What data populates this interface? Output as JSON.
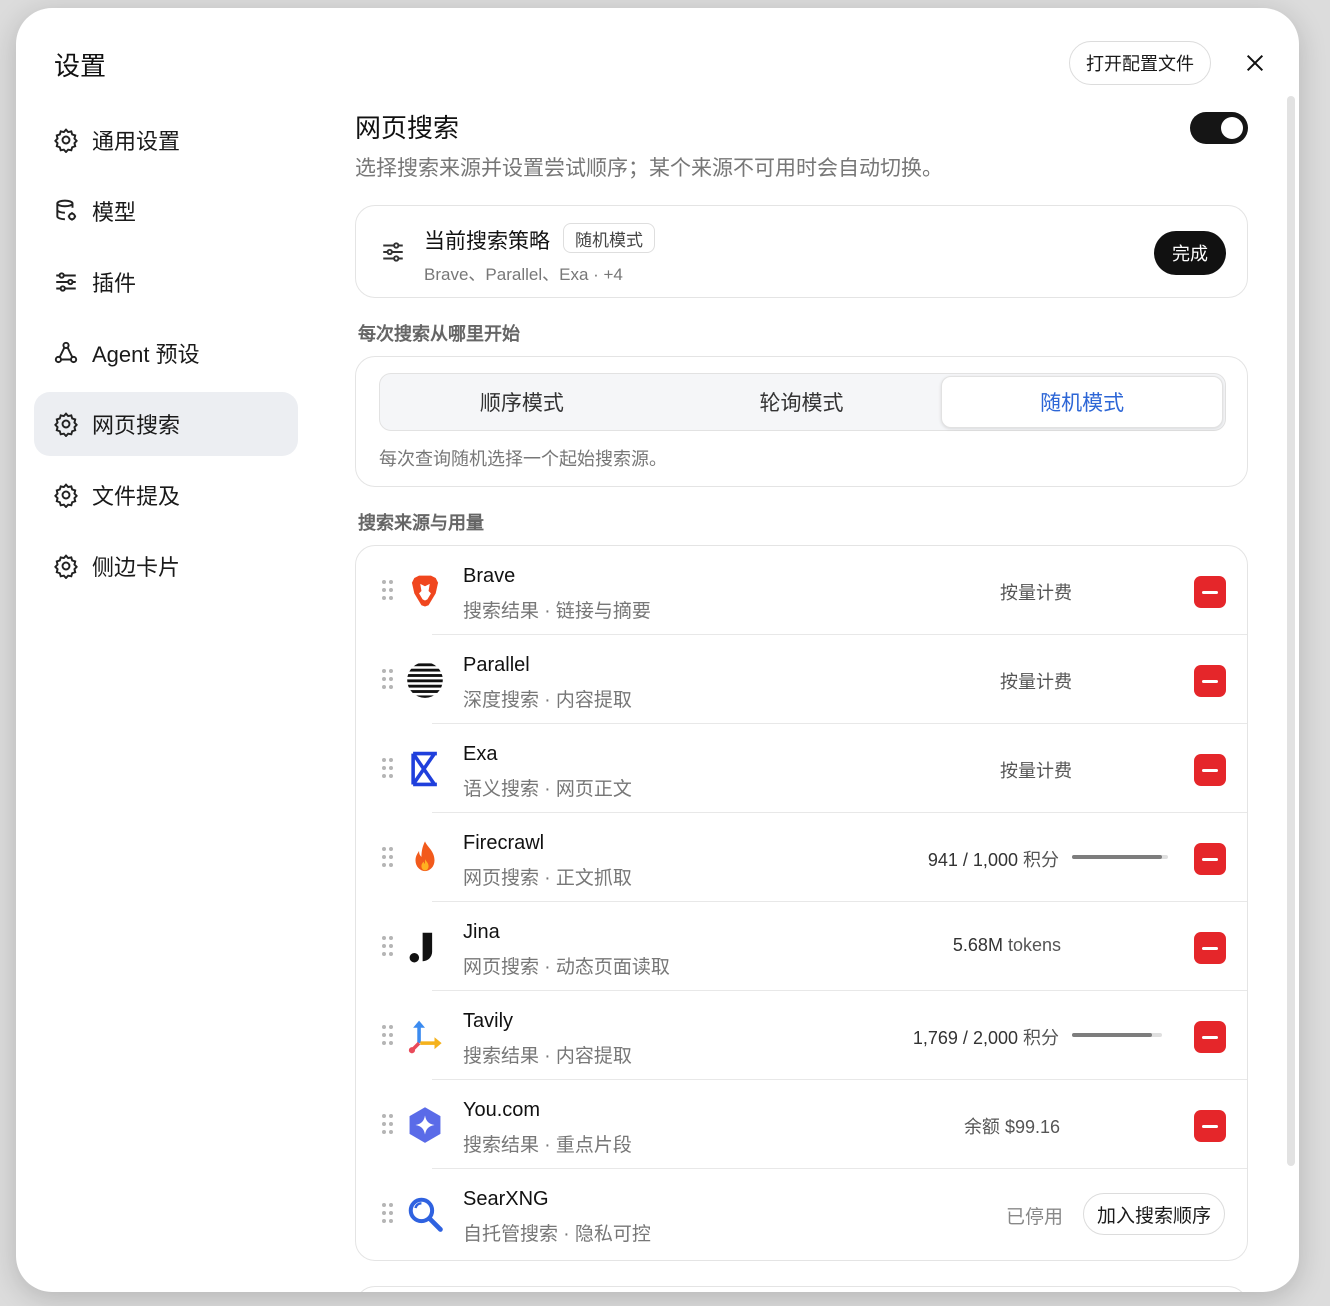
{
  "modal": {
    "title": "设置",
    "open_config_label": "打开配置文件"
  },
  "nav": [
    {
      "label": "通用设置",
      "icon": "gear-icon"
    },
    {
      "label": "模型",
      "icon": "database-icon"
    },
    {
      "label": "插件",
      "icon": "sliders-icon"
    },
    {
      "label": "Agent 预设",
      "icon": "agent-icon"
    },
    {
      "label": "网页搜索",
      "icon": "gear-icon",
      "active": true
    },
    {
      "label": "文件提及",
      "icon": "gear-icon"
    },
    {
      "label": "侧边卡片",
      "icon": "gear-icon"
    }
  ],
  "web_search": {
    "title": "网页搜索",
    "description": "选择搜索来源并设置尝试顺序；某个来源不可用时会自动切换。",
    "enabled": true,
    "strategy": {
      "title": "当前搜索策略",
      "badge": "随机模式",
      "summary": "Brave、Parallel、Exa · +4",
      "done_label": "完成"
    },
    "start_label": "每次搜索从哪里开始",
    "modes": [
      "顺序模式",
      "轮询模式",
      "随机模式"
    ],
    "active_mode": "随机模式",
    "mode_description": "每次查询随机选择一个起始搜索源。",
    "sources_label": "搜索来源与用量",
    "sources": [
      {
        "name": "Brave",
        "desc": "搜索结果 · 链接与摘要",
        "usage": "按量计费",
        "logo": "brave-lion-icon",
        "color": "#f0461e"
      },
      {
        "name": "Parallel",
        "desc": "深度搜索 · 内容提取",
        "usage": "按量计费",
        "logo": "parallel-stripes-icon",
        "color": "#111111"
      },
      {
        "name": "Exa",
        "desc": "语义搜索 · 网页正文",
        "usage": "按量计费",
        "logo": "exa-hourglass-icon",
        "color": "#1f3fdc"
      },
      {
        "name": "Firecrawl",
        "desc": "网页搜索 · 正文抓取",
        "usage_num": "941 / 1,000",
        "usage_unit": "积分",
        "fraction": 0.941,
        "logo": "firecrawl-flame-icon",
        "color": "#f25a1c"
      },
      {
        "name": "Jina",
        "desc": "网页搜索 · 动态页面读取",
        "usage_num": "5.68M",
        "usage_unit": "tokens",
        "logo": "jina-icon",
        "color": "#111111"
      },
      {
        "name": "Tavily",
        "desc": "搜索结果 · 内容提取",
        "usage_num": "1,769 / 2,000",
        "usage_unit": "积分",
        "fraction": 0.8845,
        "logo": "tavily-arrows-icon",
        "color": "#3b8bf0"
      },
      {
        "name": "You.com",
        "desc": "搜索结果 · 重点片段",
        "usage": "余额 $99.16",
        "logo": "youcom-star-icon",
        "color": "#5a6be8"
      },
      {
        "name": "SearXNG",
        "desc": "自托管搜索 · 隐私可控",
        "status": "已停用",
        "add_label": "加入搜索顺序",
        "logo": "searxng-magnifier-icon",
        "color": "#2f62e0"
      }
    ]
  },
  "colors": {
    "accent": "#2d66d6",
    "danger": "#e5262a",
    "toggle_on": "#151515"
  }
}
